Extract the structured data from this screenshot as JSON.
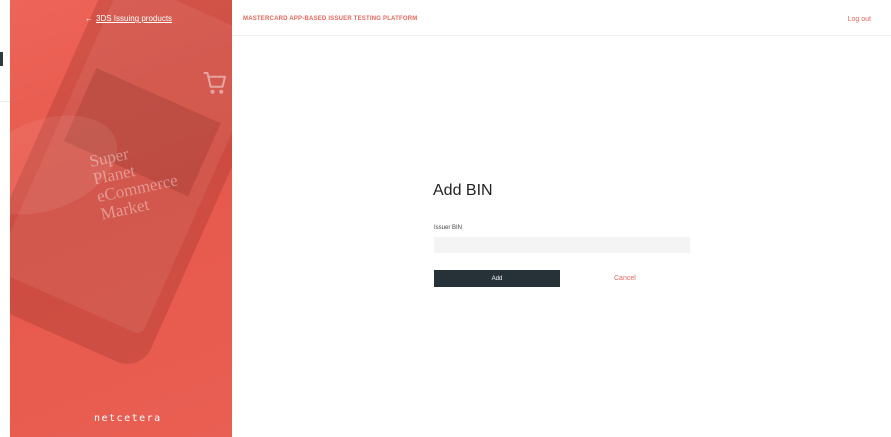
{
  "left_panel": {
    "back_link": {
      "arrow": "←",
      "label": "3DS Issuing products"
    },
    "promo_lines": [
      "Super",
      "Planet",
      "eCommerce",
      "Market"
    ],
    "cart_icon": "shopping-cart-icon",
    "logo": "netcetera"
  },
  "header": {
    "title": "MASTERCARD APP-BASED ISSUER TESTING PLATFORM",
    "logout": "Log out"
  },
  "form": {
    "title": "Add BIN",
    "bin_label": "Issuer BIN",
    "bin_value": "",
    "bin_placeholder": "",
    "add_button": "Add",
    "cancel": "Cancel"
  },
  "colors": {
    "accent": "#e8665b",
    "panel": "#ea5f53",
    "button": "#263238"
  }
}
